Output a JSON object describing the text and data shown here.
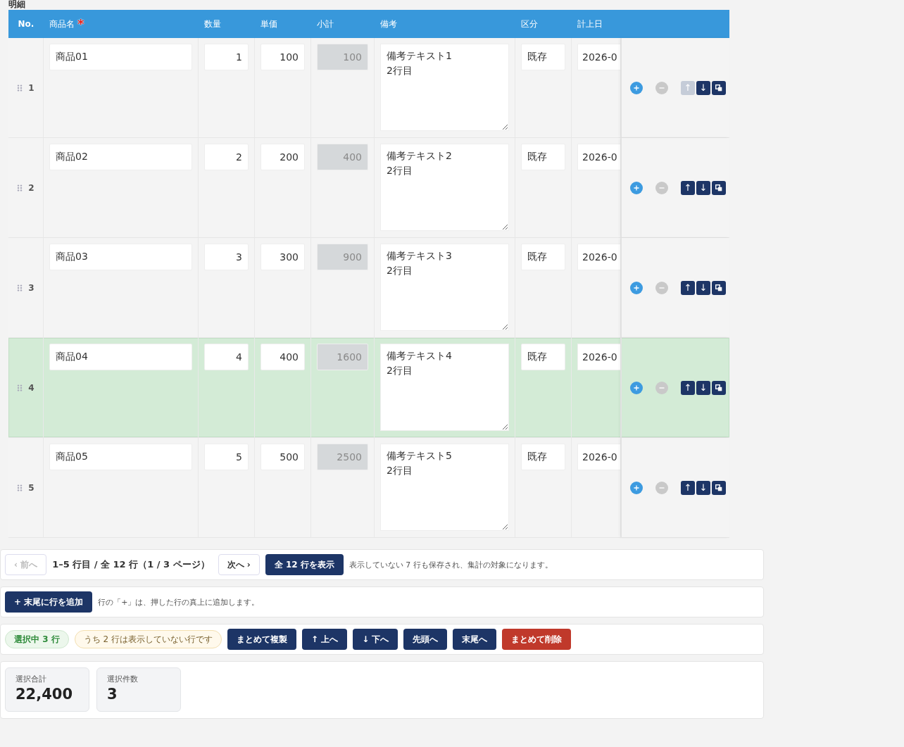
{
  "section_title": "明細",
  "table": {
    "columns": [
      {
        "label": "No."
      },
      {
        "label": "商品名",
        "required_mark": "*"
      },
      {
        "label": "数量"
      },
      {
        "label": "単価"
      },
      {
        "label": "小計"
      },
      {
        "label": "備考"
      },
      {
        "label": "区分"
      },
      {
        "label": "計上日"
      }
    ],
    "row_buttons": {
      "up": "↑",
      "down": "↓"
    },
    "rows": [
      {
        "no": "1",
        "name": "商品01",
        "qty": "1",
        "price": "100",
        "subtotal": "100",
        "note": "備考テキスト1\n2行目",
        "category": "既存",
        "date": "2026-0",
        "selected": false,
        "up_disabled": true,
        "remove_disabled": true
      },
      {
        "no": "2",
        "name": "商品02",
        "qty": "2",
        "price": "200",
        "subtotal": "400",
        "note": "備考テキスト2\n2行目",
        "category": "既存",
        "date": "2026-0",
        "selected": false,
        "up_disabled": false,
        "remove_disabled": true
      },
      {
        "no": "3",
        "name": "商品03",
        "qty": "3",
        "price": "300",
        "subtotal": "900",
        "note": "備考テキスト3\n2行目",
        "category": "既存",
        "date": "2026-0",
        "selected": false,
        "up_disabled": false,
        "remove_disabled": true
      },
      {
        "no": "4",
        "name": "商品04",
        "qty": "4",
        "price": "400",
        "subtotal": "1600",
        "note": "備考テキスト4\n2行目",
        "category": "既存",
        "date": "2026-0",
        "selected": true,
        "up_disabled": false,
        "remove_disabled": true
      },
      {
        "no": "5",
        "name": "商品05",
        "qty": "5",
        "price": "500",
        "subtotal": "2500",
        "note": "備考テキスト5\n2行目",
        "category": "既存",
        "date": "2026-0",
        "selected": false,
        "up_disabled": false,
        "remove_disabled": true
      }
    ]
  },
  "pagination": {
    "prev": "‹ 前へ",
    "prev_disabled": true,
    "range": "1–5 行目 / 全 12 行（1 / 3 ページ）",
    "next": "次へ ›",
    "show_all": "全 12 行を表示",
    "note": "表示していない 7 行も保存され、集計の対象になります。"
  },
  "add_row": {
    "button": "+ 末尾に行を追加",
    "hint": "行の「+」は、押した行の真上に追加します。"
  },
  "selection": {
    "count_badge": "選択中 3 行",
    "hidden_badge": "うち 2 行は表示していない行です",
    "actions": [
      {
        "label": "まとめて複製",
        "kind": "normal"
      },
      {
        "label": "↑ 上へ",
        "kind": "normal"
      },
      {
        "label": "↓ 下へ",
        "kind": "normal"
      },
      {
        "label": "先頭へ",
        "kind": "normal"
      },
      {
        "label": "末尾へ",
        "kind": "normal"
      },
      {
        "label": "まとめて削除",
        "kind": "danger"
      }
    ]
  },
  "summary": [
    {
      "label": "選択合計",
      "value": "22,400"
    },
    {
      "label": "選択件数",
      "value": "3"
    }
  ]
}
